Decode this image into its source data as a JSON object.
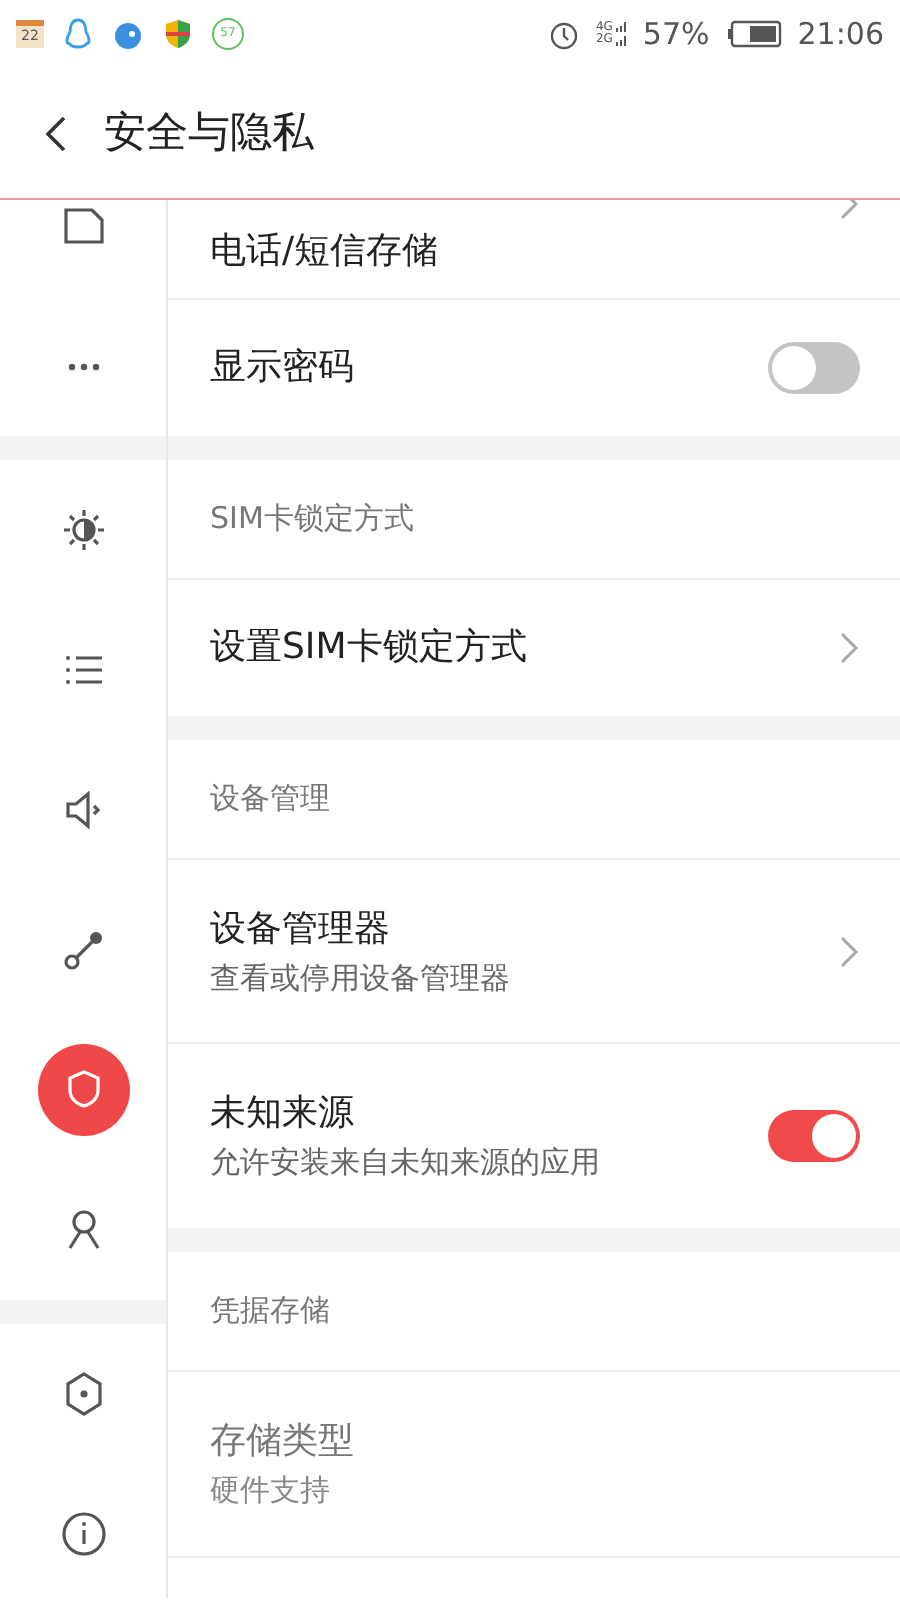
{
  "status_bar": {
    "calendar_day": "22",
    "badge_number": "57",
    "network_top": "4G",
    "network_bottom": "2G",
    "battery": "57%",
    "time": "21:06"
  },
  "header": {
    "title": "安全与隐私"
  },
  "rail_groups": [
    [
      {
        "selected": false
      },
      {
        "selected": false
      }
    ],
    [
      {
        "selected": false
      },
      {
        "selected": false
      },
      {
        "selected": false
      },
      {
        "selected": false
      },
      {
        "selected": true
      },
      {
        "selected": false
      }
    ],
    [
      {
        "selected": false
      },
      {
        "selected": false
      }
    ]
  ],
  "sections": [
    {
      "items": [
        {
          "kind": "link",
          "title": "电话/短信存储",
          "disabled": false
        },
        {
          "kind": "toggle",
          "title": "显示密码",
          "on": false,
          "disabled": false
        }
      ]
    },
    {
      "header": "SIM卡锁定方式",
      "items": [
        {
          "kind": "link",
          "title": "设置SIM卡锁定方式",
          "disabled": false
        }
      ]
    },
    {
      "header": "设备管理",
      "items": [
        {
          "kind": "link",
          "title": "设备管理器",
          "subtitle": "查看或停用设备管理器",
          "disabled": false
        },
        {
          "kind": "toggle",
          "title": "未知来源",
          "subtitle": "允许安装来自未知来源的应用",
          "on": true,
          "disabled": false
        }
      ]
    },
    {
      "header": "凭据存储",
      "items": [
        {
          "kind": "info",
          "title": "存储类型",
          "subtitle": "硬件支持",
          "disabled": true
        }
      ]
    }
  ]
}
